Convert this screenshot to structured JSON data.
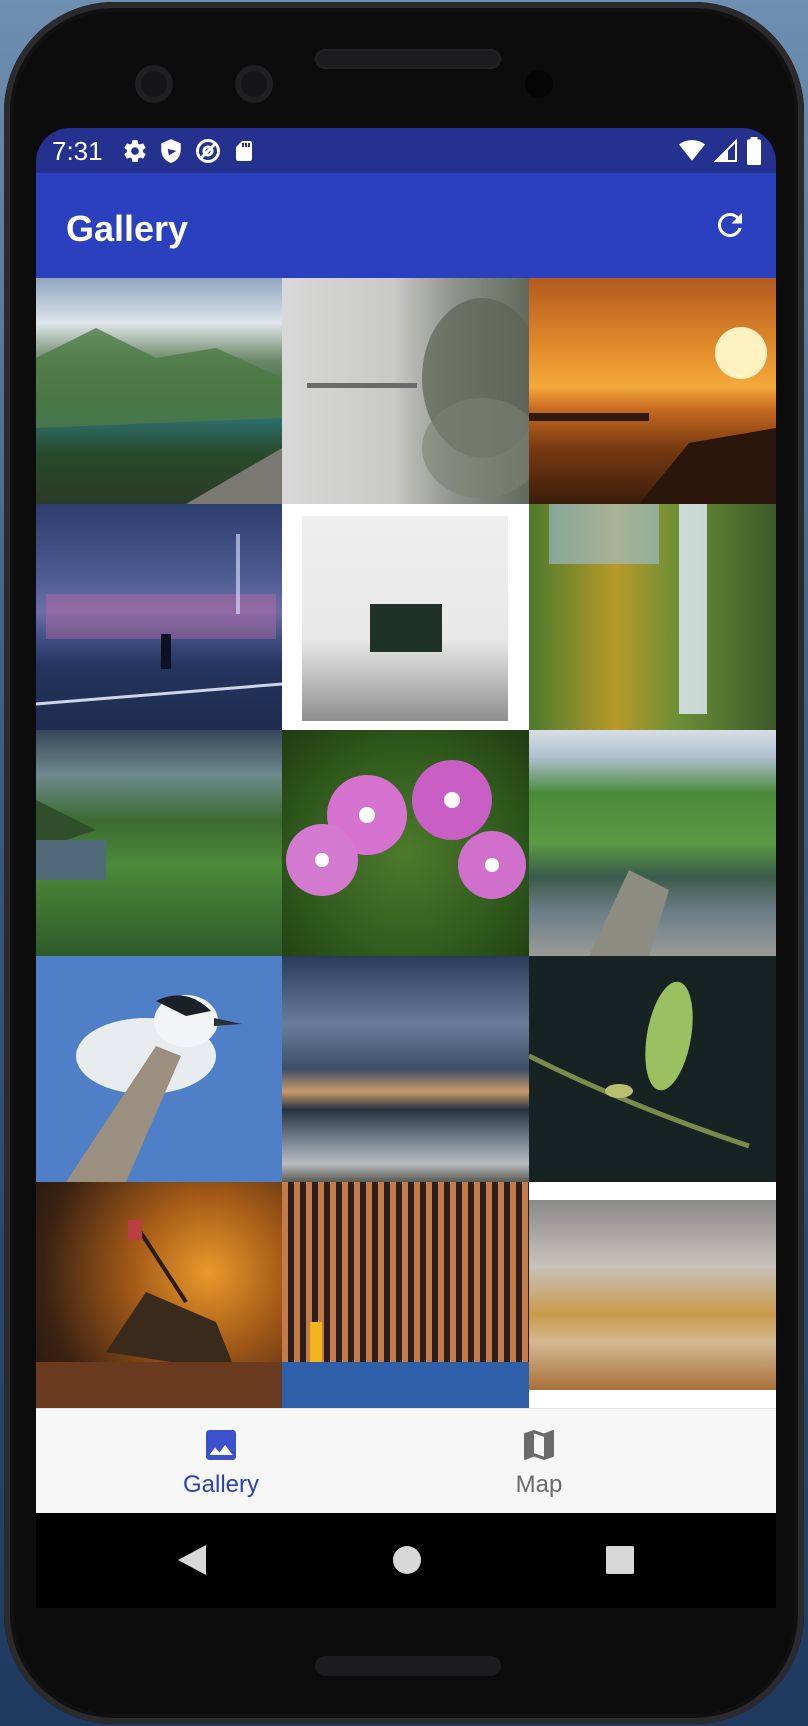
{
  "status_bar": {
    "time": "7:31",
    "left_icons": [
      "settings-icon",
      "shield-icon",
      "at-sign-icon",
      "sd-card-icon"
    ],
    "right_icons": [
      "wifi-icon",
      "cell-signal-icon",
      "battery-icon"
    ]
  },
  "app_bar": {
    "title": "Gallery",
    "action_icon": "refresh-icon"
  },
  "colors": {
    "status_bar": "#25318f",
    "app_bar": "#2b40bf",
    "nav_active": "#2b40bf",
    "nav_inactive": "#6b6b6b"
  },
  "gallery": {
    "columns": 3,
    "visible_thumbnails": 15
  },
  "bottom_nav": {
    "items": [
      {
        "label": "Gallery",
        "icon": "image-icon",
        "selected": true
      },
      {
        "label": "Map",
        "icon": "map-icon",
        "selected": false
      }
    ]
  },
  "system_nav": [
    "back-icon",
    "home-icon",
    "recents-icon"
  ]
}
